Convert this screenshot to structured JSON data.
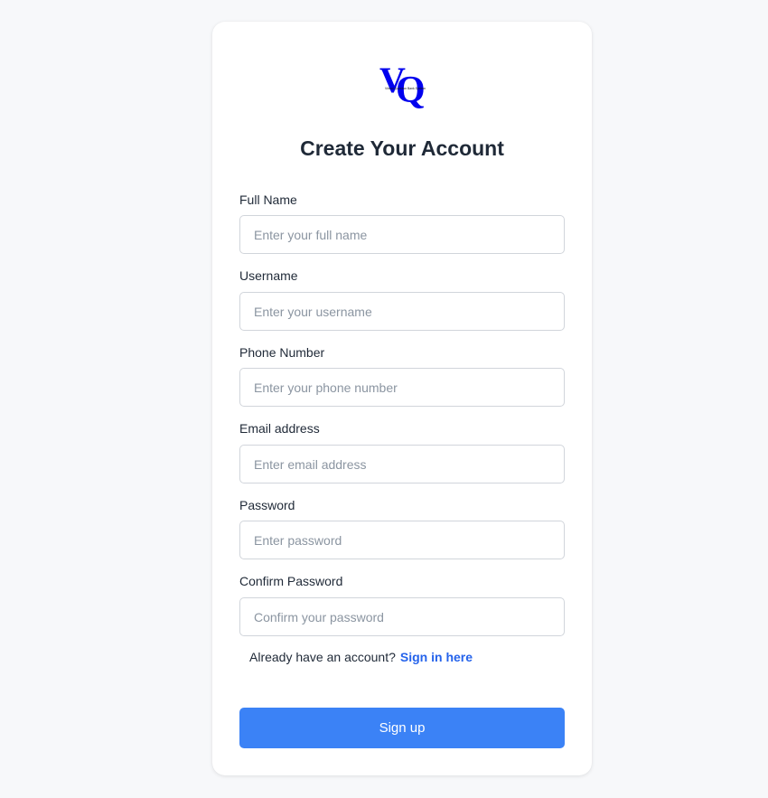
{
  "logo": {
    "letters": "VQ",
    "tagline": "Virtual Question Bank System",
    "color": "#0000ee"
  },
  "title": "Create Your Account",
  "fields": [
    {
      "label": "Full Name",
      "placeholder": "Enter your full name",
      "value": ""
    },
    {
      "label": "Username",
      "placeholder": "Enter your username",
      "value": ""
    },
    {
      "label": "Phone Number",
      "placeholder": "Enter your phone number",
      "value": ""
    },
    {
      "label": "Email address",
      "placeholder": "Enter email address",
      "value": ""
    },
    {
      "label": "Password",
      "placeholder": "Enter password",
      "value": ""
    },
    {
      "label": "Confirm Password",
      "placeholder": "Confirm your password",
      "value": ""
    }
  ],
  "signin": {
    "prompt": "Already have an account?",
    "link": "Sign in here"
  },
  "submit_label": "Sign up",
  "colors": {
    "page_background": "#f7f8fa",
    "primary_button": "#3b82f6",
    "link": "#2563eb",
    "title": "#1f2937"
  }
}
